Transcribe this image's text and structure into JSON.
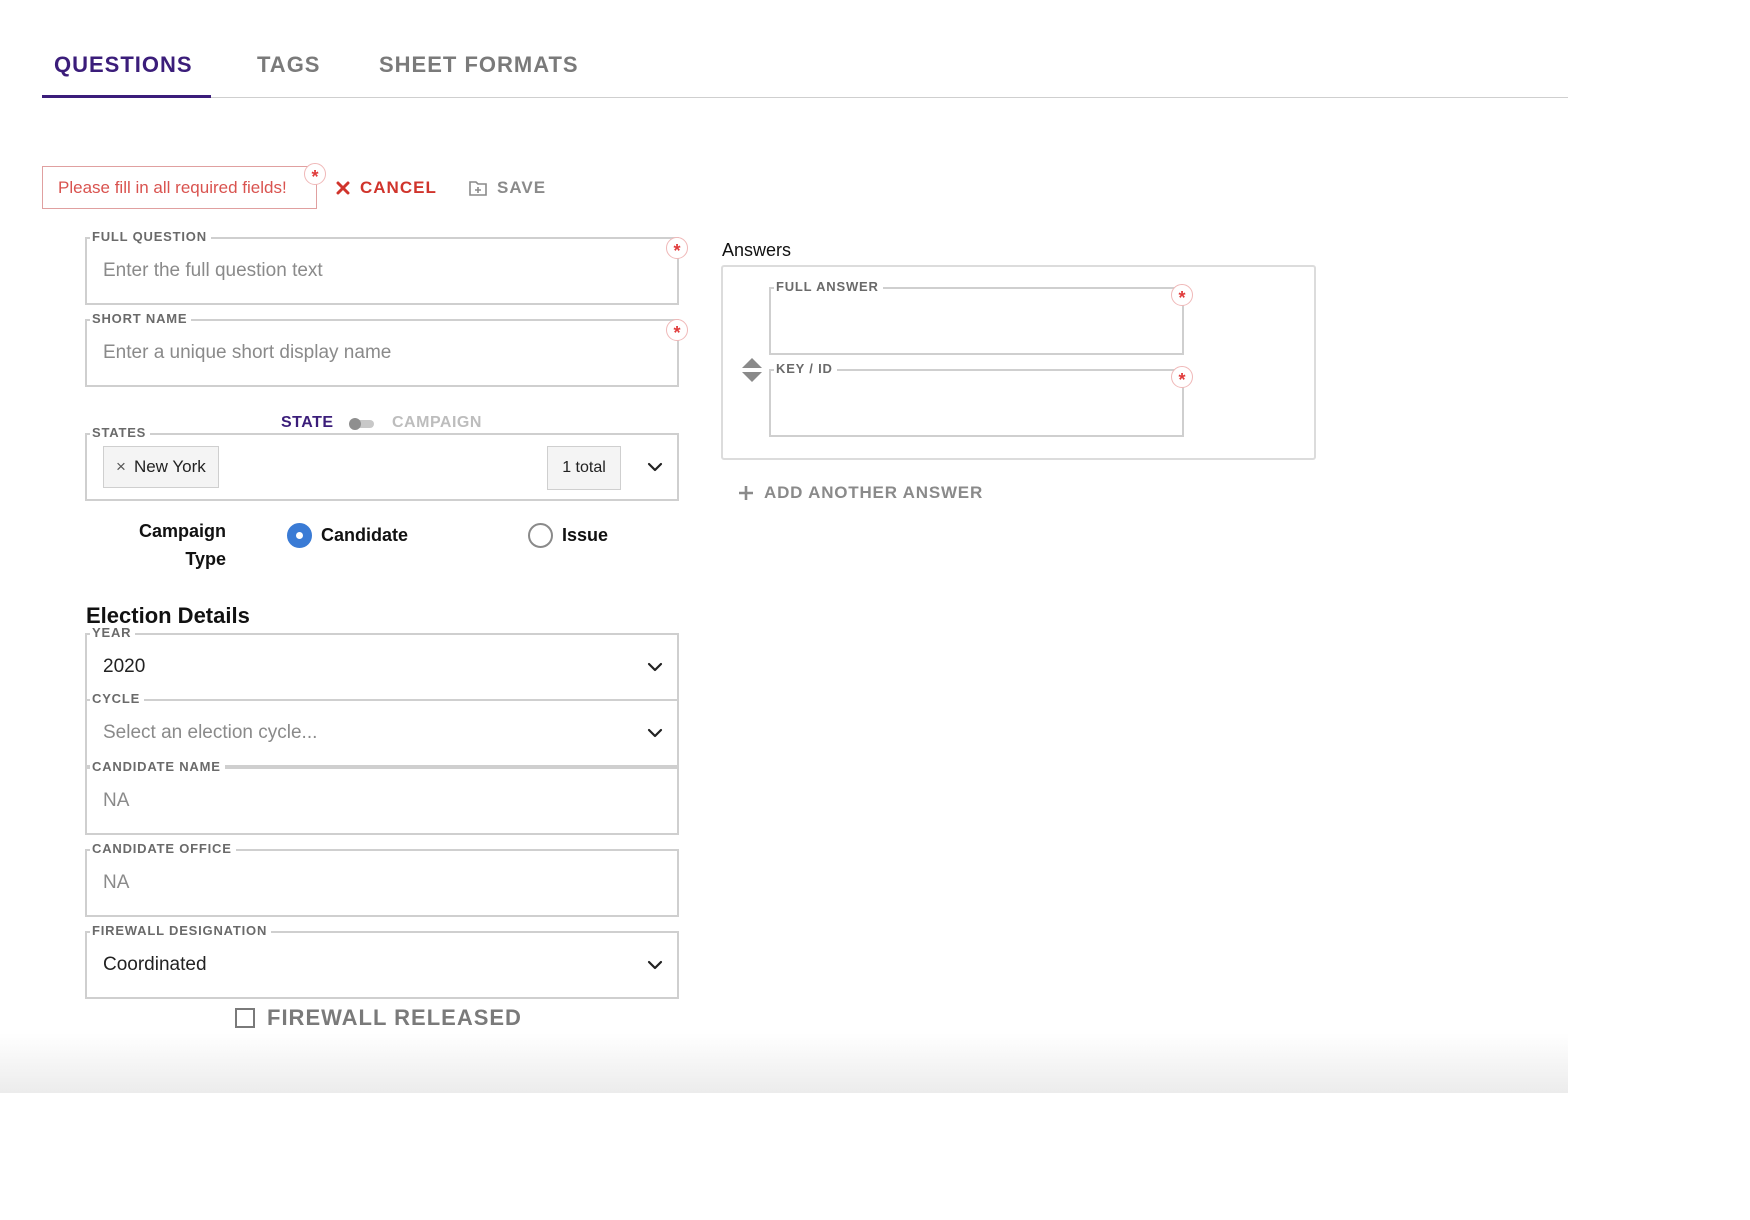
{
  "tabs": [
    {
      "label": "QUESTIONS",
      "active": true
    },
    {
      "label": "TAGS",
      "active": false
    },
    {
      "label": "SHEET FORMATS",
      "active": false
    }
  ],
  "action_bar": {
    "error_message": "Please fill in all required fields!",
    "cancel_label": "CANCEL",
    "save_label": "SAVE"
  },
  "required_marker": "*",
  "form": {
    "full_question": {
      "label": "FULL QUESTION",
      "placeholder": "Enter the full question text",
      "value": ""
    },
    "short_name": {
      "label": "SHORT NAME",
      "placeholder": "Enter a unique short display name",
      "value": ""
    },
    "scope_toggle": {
      "left_label": "STATE",
      "right_label": "CAMPAIGN",
      "selected": "STATE"
    },
    "states": {
      "label": "STATES",
      "selected_chips": [
        "New York"
      ],
      "chip_remove_glyph": "×",
      "total_label": "1 total"
    },
    "campaign_type": {
      "label_line1": "Campaign",
      "label_line2": "Type",
      "options": [
        {
          "label": "Candidate",
          "checked": true
        },
        {
          "label": "Issue",
          "checked": false
        }
      ]
    },
    "election_details": {
      "title": "Election Details",
      "year": {
        "label": "YEAR",
        "value": "2020"
      },
      "cycle": {
        "label": "CYCLE",
        "placeholder": "Select an election cycle..."
      },
      "candidate_name": {
        "label": "CANDIDATE NAME",
        "value": "NA"
      },
      "candidate_office": {
        "label": "CANDIDATE OFFICE",
        "value": "NA"
      },
      "firewall_designation": {
        "label": "FIREWALL DESIGNATION",
        "value": "Coordinated"
      },
      "firewall_released": {
        "label": "FIREWALL RELEASED",
        "checked": false
      }
    }
  },
  "answers": {
    "title": "Answers",
    "items": [
      {
        "full_answer_label": "FULL ANSWER",
        "full_answer_value": "",
        "key_label": "KEY / ID",
        "key_value": ""
      }
    ],
    "add_label": "ADD ANOTHER ANSWER"
  },
  "colors": {
    "accent_purple": "#3b1d7a",
    "error_red": "#d0342c",
    "radio_blue": "#3a7bd5",
    "muted_gray": "#8a8a8a"
  },
  "icons": {
    "cancel": "close-icon",
    "save": "folder-add-icon",
    "dropdown": "chevron-down-icon",
    "sort": "sort-handle-icon",
    "add": "plus-icon"
  }
}
